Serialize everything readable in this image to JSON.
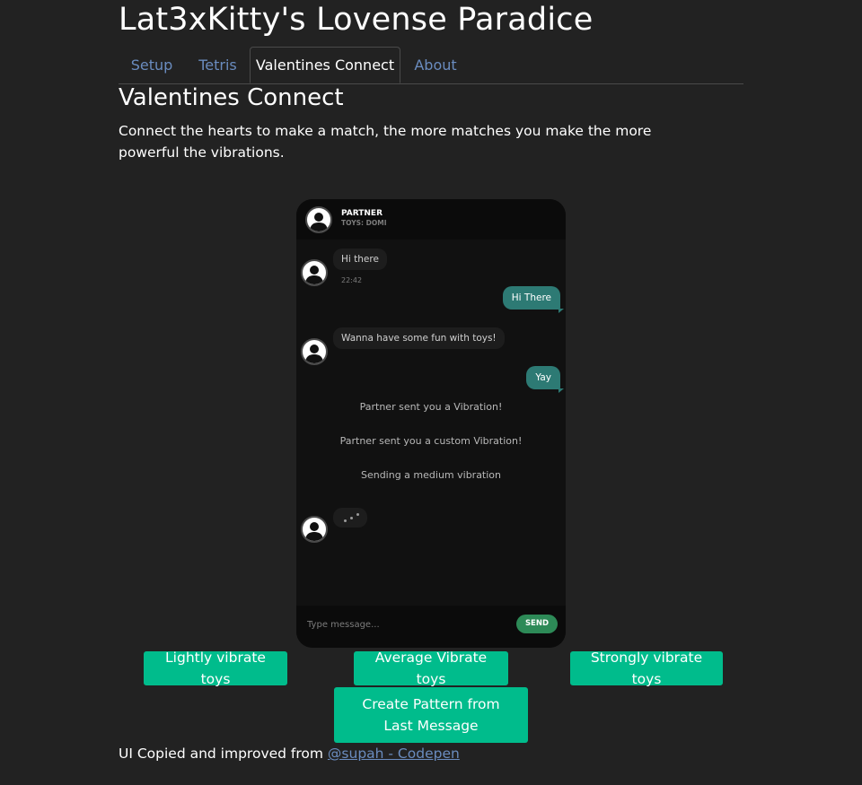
{
  "site_title": "Lat3xKitty's Lovense Paradice",
  "tabs": [
    {
      "label": "Setup",
      "active": false
    },
    {
      "label": "Tetris",
      "active": false
    },
    {
      "label": "Valentines Connect",
      "active": true
    },
    {
      "label": "About",
      "active": false
    }
  ],
  "page": {
    "heading": "Valentines Connect",
    "description": "Connect the hearts to make a match, the more matches you make the more powerful the vibrations."
  },
  "chat": {
    "partner_name": "PARTNER",
    "partner_toys": "TOYS: DOMI",
    "messages": [
      {
        "from": "partner",
        "text": "Hi there",
        "time": "22:42"
      },
      {
        "from": "me",
        "text": "Hi There"
      },
      {
        "from": "partner",
        "text": "Wanna have some fun with toys!"
      },
      {
        "from": "me",
        "text": "Yay"
      }
    ],
    "system_messages": [
      "Partner sent you a Vibration!",
      "Partner sent you a custom Vibration!",
      "Sending a medium vibration"
    ],
    "input_placeholder": "Type message...",
    "send_label": "SEND"
  },
  "buttons": {
    "light": "Lightly vibrate toys",
    "average": "Average Vibrate toys",
    "strong": "Strongly vibrate toys",
    "pattern": "Create Pattern from Last Message"
  },
  "footer": {
    "text": "UI Copied and improved from ",
    "link_text": "@supah - Codepen"
  },
  "colors": {
    "background": "#222222",
    "accent": "#00bc8c",
    "link": "#6a8cbf",
    "outgoing_bubble": "#2d7a74",
    "send_button": "#2d8a57"
  }
}
